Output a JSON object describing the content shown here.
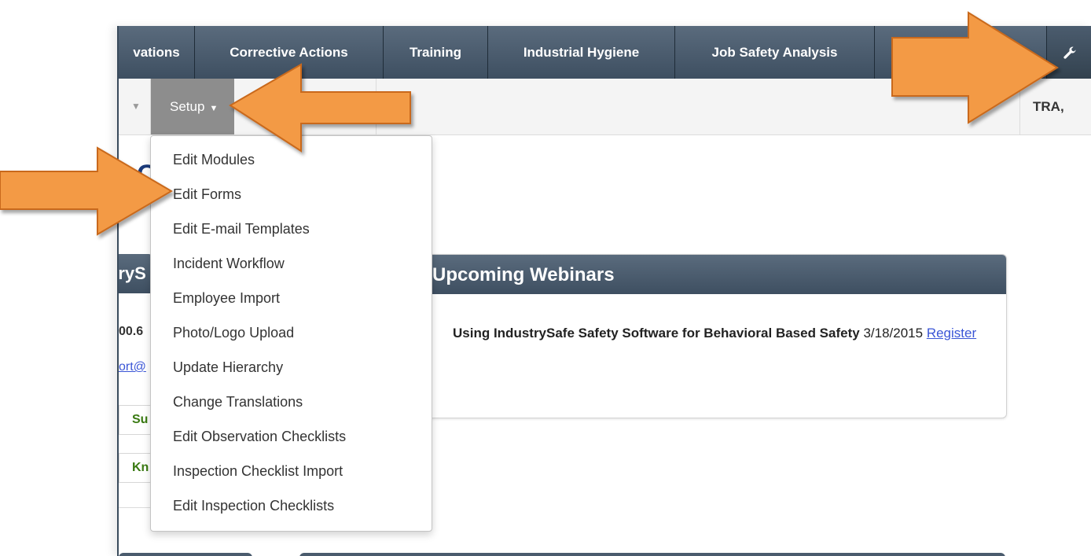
{
  "topnav": {
    "tabs": [
      {
        "label": "vations"
      },
      {
        "label": "Corrective Actions"
      },
      {
        "label": "Training"
      },
      {
        "label": "Industrial Hygiene"
      },
      {
        "label": "Job Safety Analysis"
      }
    ],
    "settings_icon": "wrench-icon"
  },
  "subnav": {
    "setup_label": "Setup",
    "right_label": "TRA,"
  },
  "page": {
    "partial_letter": "C",
    "left_panel_title": "tryS",
    "left_phone": "00.6",
    "left_email": "ort@",
    "left_box_1": "Su",
    "left_box_2": "Kn"
  },
  "webinars": {
    "title": "Upcoming Webinars",
    "item_title": "Using IndustrySafe Safety Software for Behavioral Based Safety",
    "item_date": "3/18/2015",
    "register_label": "Register"
  },
  "setup_menu": {
    "items": [
      "Edit Modules",
      "Edit Forms",
      "Edit E-mail Templates",
      "Incident Workflow",
      "Employee Import",
      "Photo/Logo Upload",
      "Update Hierarchy",
      "Change Translations",
      "Edit Observation Checklists",
      "Inspection Checklist Import",
      "Edit Inspection Checklists"
    ]
  },
  "annotation_arrow_color": "#f39a45"
}
